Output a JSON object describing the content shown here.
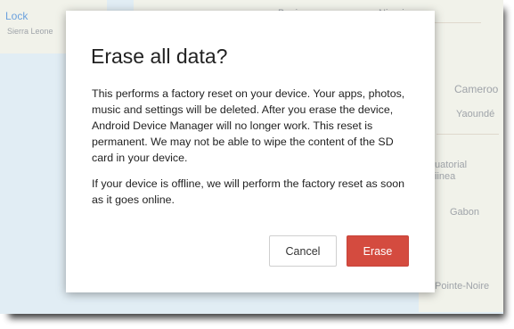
{
  "map": {
    "lock_link": "Lock",
    "labels": [
      "Benin",
      "Nigeria",
      "Cameroo",
      "Yaoundé",
      "Gabon",
      "Pointe-Noire",
      "uatorial",
      "iinea",
      "Sierra Leone"
    ]
  },
  "dialog": {
    "title": "Erase all data?",
    "body_1": "This performs a factory reset on your device. Your apps, photos, music and settings will be deleted. After you erase the device, Android Device Manager will no longer work. This reset is permanent. We may not be able to wipe the content of the SD card in your device.",
    "body_2": "If your device is offline, we will perform the factory reset as soon as it goes online.",
    "cancel_label": "Cancel",
    "erase_label": "Erase"
  },
  "colors": {
    "erase_button": "#d44b3f",
    "link": "#4b8dd6"
  }
}
